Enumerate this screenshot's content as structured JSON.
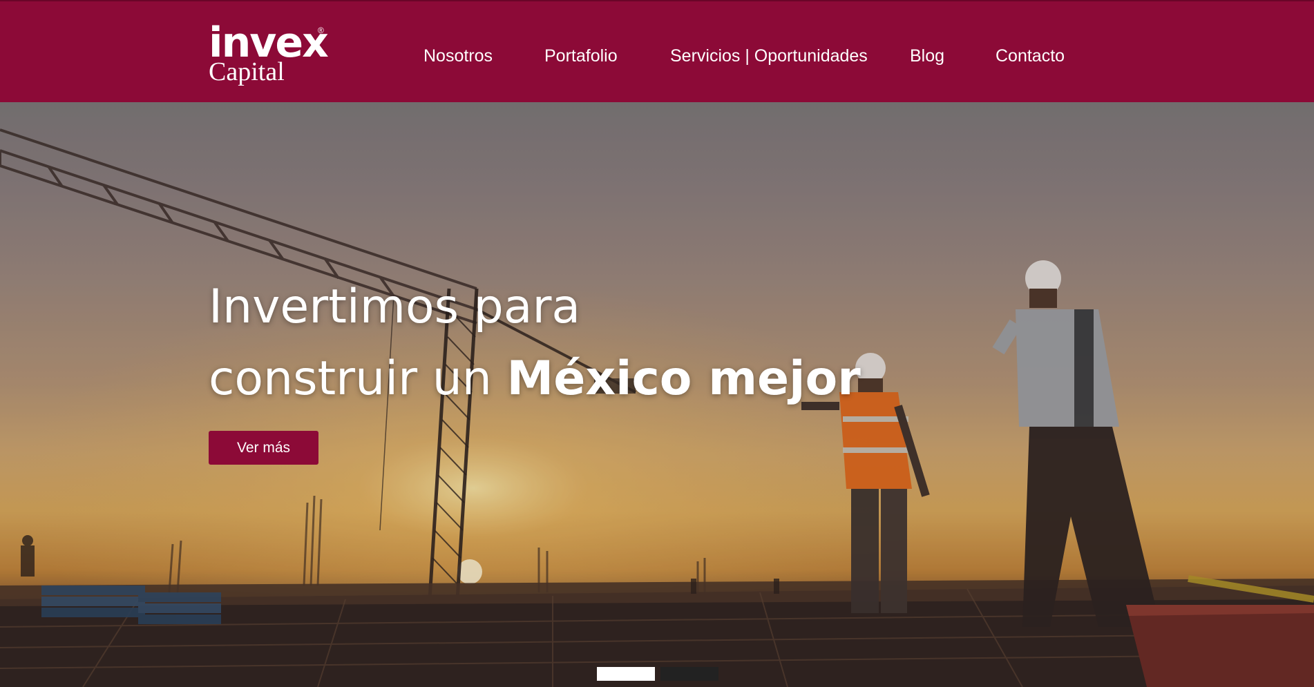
{
  "brand": {
    "wordmark": "invex",
    "registered": "®",
    "subtitle": "Capital"
  },
  "nav": {
    "items": [
      {
        "label": "Nosotros"
      },
      {
        "label": "Portafolio"
      },
      {
        "label": "Servicios | Oportunidades"
      },
      {
        "label": "Blog"
      },
      {
        "label": "Contacto"
      }
    ]
  },
  "hero": {
    "headline_line1": "Invertimos para",
    "headline_line2_regular": "construir un",
    "headline_line2_bold": "México mejor",
    "cta_label": "Ver más",
    "slides_total": 2,
    "active_slide": 1
  },
  "colors": {
    "brand_primary": "#8c0a37",
    "text_on_brand": "#ffffff",
    "indicator_active": "#ffffff",
    "indicator_inactive": "#222222"
  }
}
